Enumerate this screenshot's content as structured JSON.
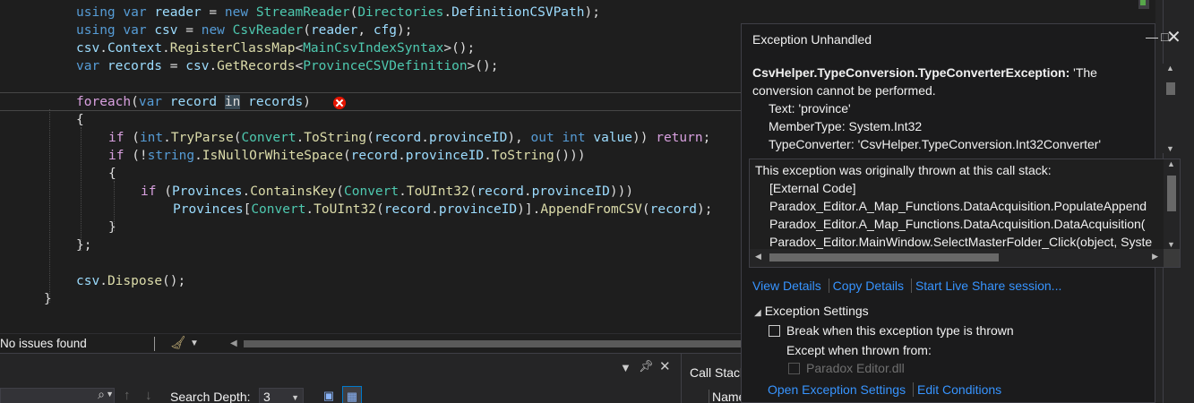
{
  "editor": {
    "lines": [
      [
        [
          "k",
          "using "
        ],
        [
          "k",
          "var "
        ],
        [
          "v",
          "reader"
        ],
        [
          "p",
          " = "
        ],
        [
          "k",
          "new "
        ],
        [
          "t",
          "StreamReader"
        ],
        [
          "p",
          "("
        ],
        [
          "t",
          "Directories"
        ],
        [
          "p",
          "."
        ],
        [
          "v",
          "DefinitionCSVPath"
        ],
        [
          "p",
          ");"
        ]
      ],
      [
        [
          "k",
          "using "
        ],
        [
          "k",
          "var "
        ],
        [
          "v",
          "csv"
        ],
        [
          "p",
          " = "
        ],
        [
          "k",
          "new "
        ],
        [
          "t",
          "CsvReader"
        ],
        [
          "p",
          "("
        ],
        [
          "v",
          "reader"
        ],
        [
          "p",
          ", "
        ],
        [
          "v",
          "cfg"
        ],
        [
          "p",
          ");"
        ]
      ],
      [
        [
          "v",
          "csv"
        ],
        [
          "p",
          "."
        ],
        [
          "v",
          "Context"
        ],
        [
          "p",
          "."
        ],
        [
          "f",
          "RegisterClassMap"
        ],
        [
          "p",
          "<"
        ],
        [
          "t",
          "MainCsvIndexSyntax"
        ],
        [
          "p",
          ">();"
        ]
      ],
      [
        [
          "k",
          "var "
        ],
        [
          "v",
          "records"
        ],
        [
          "p",
          " = "
        ],
        [
          "v",
          "csv"
        ],
        [
          "p",
          "."
        ],
        [
          "f",
          "GetRecords"
        ],
        [
          "p",
          "<"
        ],
        [
          "t",
          "ProvinceCSVDefinition"
        ],
        [
          "p",
          ">();"
        ]
      ],
      [],
      [
        [
          "ctl",
          "foreach"
        ],
        [
          "p",
          "("
        ],
        [
          "k",
          "var "
        ],
        [
          "v",
          "record"
        ],
        [
          "p",
          " "
        ],
        [
          "hl",
          "in"
        ],
        [
          "p",
          " "
        ],
        [
          "v",
          "records"
        ],
        [
          "p",
          ")"
        ]
      ],
      [
        [
          "p",
          "{"
        ]
      ],
      [
        [
          "ctl",
          "if"
        ],
        [
          "p",
          " ("
        ],
        [
          "k",
          "int"
        ],
        [
          "p",
          "."
        ],
        [
          "f",
          "TryParse"
        ],
        [
          "p",
          "("
        ],
        [
          "t",
          "Convert"
        ],
        [
          "p",
          "."
        ],
        [
          "f",
          "ToString"
        ],
        [
          "p",
          "("
        ],
        [
          "v",
          "record"
        ],
        [
          "p",
          "."
        ],
        [
          "v",
          "provinceID"
        ],
        [
          "p",
          "), "
        ],
        [
          "k",
          "out "
        ],
        [
          "k",
          "int "
        ],
        [
          "v",
          "value"
        ],
        [
          "p",
          ")) "
        ],
        [
          "ctl",
          "return"
        ],
        [
          "p",
          ";"
        ]
      ],
      [
        [
          "ctl",
          "if"
        ],
        [
          "p",
          " (!"
        ],
        [
          "k",
          "string"
        ],
        [
          "p",
          "."
        ],
        [
          "f",
          "IsNullOrWhiteSpace"
        ],
        [
          "p",
          "("
        ],
        [
          "v",
          "record"
        ],
        [
          "p",
          "."
        ],
        [
          "v",
          "provinceID"
        ],
        [
          "p",
          "."
        ],
        [
          "f",
          "ToString"
        ],
        [
          "p",
          "()))"
        ]
      ],
      [
        [
          "p",
          "{"
        ]
      ],
      [
        [
          "ctl",
          "if"
        ],
        [
          "p",
          " ("
        ],
        [
          "v",
          "Provinces"
        ],
        [
          "p",
          "."
        ],
        [
          "f",
          "ContainsKey"
        ],
        [
          "p",
          "("
        ],
        [
          "t",
          "Convert"
        ],
        [
          "p",
          "."
        ],
        [
          "f",
          "ToUInt32"
        ],
        [
          "p",
          "("
        ],
        [
          "v",
          "record"
        ],
        [
          "p",
          "."
        ],
        [
          "v",
          "provinceID"
        ],
        [
          "p",
          ")))"
        ]
      ],
      [
        [
          "v",
          "Provinces"
        ],
        [
          "p",
          "["
        ],
        [
          "t",
          "Convert"
        ],
        [
          "p",
          "."
        ],
        [
          "f",
          "ToUInt32"
        ],
        [
          "p",
          "("
        ],
        [
          "v",
          "record"
        ],
        [
          "p",
          "."
        ],
        [
          "v",
          "provinceID"
        ],
        [
          "p",
          ")]."
        ],
        [
          "f",
          "AppendFromCSV"
        ],
        [
          "p",
          "("
        ],
        [
          "v",
          "record"
        ],
        [
          "p",
          ");"
        ]
      ],
      [
        [
          "p",
          "}"
        ]
      ],
      [
        [
          "p",
          "};"
        ]
      ],
      [],
      [
        [
          "v",
          "csv"
        ],
        [
          "p",
          "."
        ],
        [
          "f",
          "Dispose"
        ],
        [
          "p",
          "();"
        ]
      ],
      [
        [
          "p",
          "}"
        ]
      ]
    ]
  },
  "statusbar": {
    "issues": "No issues found"
  },
  "bottom_panel": {
    "search_depth_label": "Search Depth:",
    "search_depth_value": "3",
    "call_stack_title": "Call Stack",
    "call_stack_column": "Name"
  },
  "exception_popup": {
    "title": "Exception Unhandled",
    "exception_type": "CsvHelper.TypeConversion.TypeConverterException:",
    "message_part": " 'The conversion cannot be performed.",
    "details": [
      "Text: 'province'",
      "MemberType: System.Int32",
      "TypeConverter: 'CsvHelper.TypeConversion.Int32Converter'"
    ],
    "stack_header": "This exception was originally thrown at this call stack:",
    "stack_frames": [
      "[External Code]",
      "Paradox_Editor.A_Map_Functions.DataAcquisition.PopulateAppend",
      "Paradox_Editor.A_Map_Functions.DataAcquisition.DataAcquisition(",
      "Paradox_Editor.MainWindow.SelectMasterFolder_Click(object, Syste"
    ],
    "links": [
      "View Details",
      "Copy Details",
      "Start Live Share session..."
    ],
    "settings_header": "Exception Settings",
    "break_when_thrown": "Break when this exception type is thrown",
    "except_when_thrown_from": "Except when thrown from:",
    "excluded_module": "Paradox Editor.dll",
    "bottom_links": [
      "Open Exception Settings",
      "Edit Conditions"
    ]
  }
}
